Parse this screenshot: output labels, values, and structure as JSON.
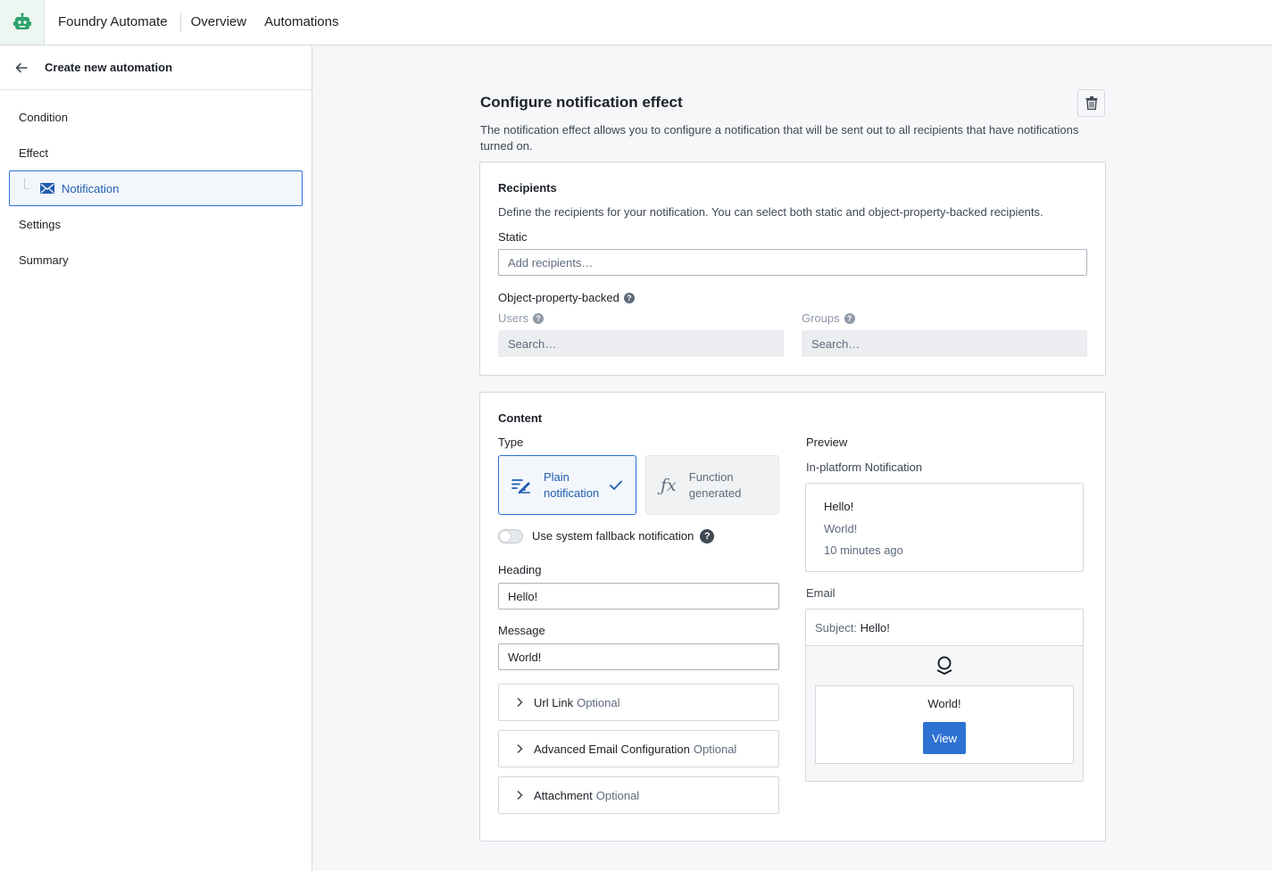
{
  "topbar": {
    "app_name": "Foundry Automate",
    "nav": [
      "Overview",
      "Automations"
    ]
  },
  "sidebar": {
    "back_title": "Create new automation",
    "items": {
      "condition": "Condition",
      "effect": "Effect",
      "notification": "Notification",
      "settings": "Settings",
      "summary": "Summary"
    }
  },
  "main": {
    "title": "Configure notification effect",
    "description": "The notification effect allows you to configure a notification that will be sent out to all recipients that have notifications turned on."
  },
  "recipients": {
    "heading": "Recipients",
    "description": "Define the recipients for your notification. You can select both static and object-property-backed recipients.",
    "static_label": "Static",
    "static_placeholder": "Add recipients…",
    "object_backed_label": "Object-property-backed",
    "users_label": "Users",
    "users_placeholder": "Search…",
    "groups_label": "Groups",
    "groups_placeholder": "Search…"
  },
  "content": {
    "heading": "Content",
    "type_label": "Type",
    "type_plain_line1": "Plain",
    "type_plain_line2": "notification",
    "type_function_line1": "Function",
    "type_function_line2": "generated",
    "fallback_label": "Use system fallback notification",
    "fallback_enabled": false,
    "heading_label": "Heading",
    "heading_value": "Hello!",
    "message_label": "Message",
    "message_value": "World!",
    "sections": [
      {
        "label": "Url Link",
        "optional": "Optional"
      },
      {
        "label": "Advanced Email Configuration",
        "optional": "Optional"
      },
      {
        "label": "Attachment",
        "optional": "Optional"
      }
    ]
  },
  "preview": {
    "label": "Preview",
    "in_platform_label": "In-platform Notification",
    "notif_title": "Hello!",
    "notif_body": "World!",
    "notif_time": "10 minutes ago",
    "email_label": "Email",
    "subject_label": "Subject:",
    "subject_value": "Hello!",
    "email_body": "World!",
    "view_button": "View"
  },
  "colors": {
    "accent": "#2d72d2",
    "logo_green": "#2ea36b"
  }
}
